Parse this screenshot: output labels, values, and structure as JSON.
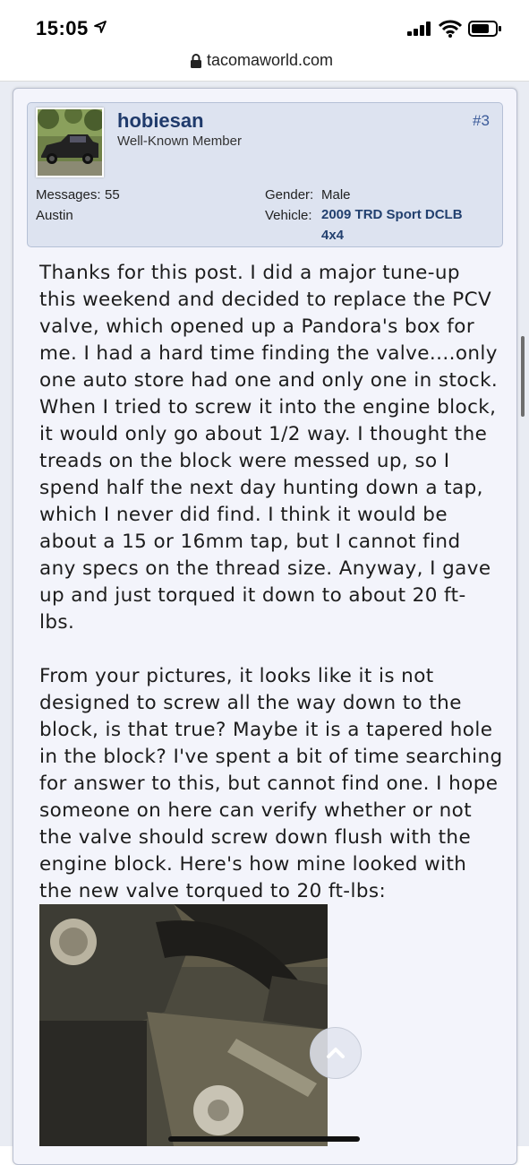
{
  "status_bar": {
    "time": "15:05"
  },
  "browser": {
    "url": "tacomaworld.com"
  },
  "post": {
    "username": "hobiesan",
    "user_title": "Well-Known Member",
    "post_number": "#3",
    "messages_label": "Messages:",
    "messages_value": "55",
    "location": "Austin",
    "gender_label": "Gender:",
    "gender_value": "Male",
    "vehicle_label": "Vehicle:",
    "vehicle_value_line1": "2009 TRD Sport DCLB",
    "vehicle_value_line2": "4x4",
    "body_lines": [
      "Thanks for this post. I did a major tune-up",
      "this weekend and decided to replace the PCV",
      "valve, which opened up a Pandora's box for",
      "me. I had a hard time finding the valve....only",
      "one auto store had one and only one in stock.",
      "When I tried to screw it into the engine block,",
      "it would only go about 1/2 way. I thought the",
      "treads on the block were messed up, so I",
      "spend half the next day hunting down a tap,",
      "which I never did find. I think it would be",
      "about a 15 or 16mm tap, but I cannot find",
      "any specs on the thread size. Anyway, I gave",
      "up and just torqued it down to about 20 ft-",
      "lbs.",
      "",
      "From your pictures, it looks like it is not",
      "designed to screw all the way down to the",
      "block, is that true? Maybe it is a tapered hole",
      "in the block? I've spent a bit of time searching",
      "for answer to this, but cannot find one. I hope",
      "someone on here can verify whether or not",
      "the valve should screw down flush with the",
      "engine block. Here's how mine looked with",
      "the new valve torqued to 20 ft-lbs:"
    ]
  }
}
